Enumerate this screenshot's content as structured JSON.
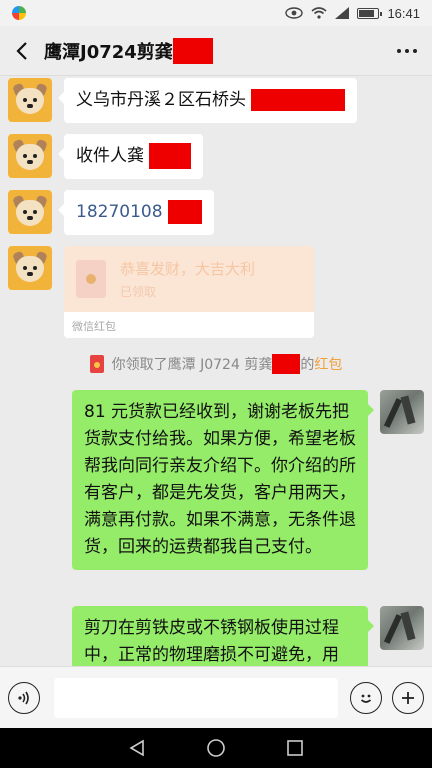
{
  "status_bar": {
    "time": "16:41",
    "battery_level": 0.85,
    "icons": [
      "app-icon",
      "eye-icon",
      "wifi-icon",
      "signal-icon",
      "battery-icon"
    ]
  },
  "header": {
    "title": "鹰潭J0724剪龚",
    "back_icon": "chevron-left-icon",
    "more_icon": "more-dots-icon"
  },
  "messages": {
    "address": "义乌市丹溪２区石桥头",
    "recipient": "收件人龚",
    "phone": "18270108",
    "red_packet": {
      "title": "恭喜发财，大吉大利",
      "status": "已领取",
      "label": "微信红包"
    },
    "system": {
      "prefix": "你领取了鹰潭 J0724 剪龚",
      "suffix": "的",
      "link": "红包"
    },
    "reply_1": "81 元货款已经收到，谢谢老板先把货款支付给我。如果方便，希望老板帮我向同行亲友介绍下。你介绍的所有客户，都是先发货，客户用两天，满意再付款。如果不满意，无条件退货，回来的运费都我自己支付。",
    "reply_2": "剪刀在剪铁皮或不锈钢板使用过程中，正常的物理磨损不可避免，用"
  },
  "input_bar": {
    "voice_icon": "voice-icon",
    "emoji_icon": "emoji-icon",
    "plus_icon": "plus-icon"
  },
  "system_nav": {
    "back": "triangle-back-icon",
    "home": "circle-home-icon",
    "recents": "square-recents-icon"
  }
}
